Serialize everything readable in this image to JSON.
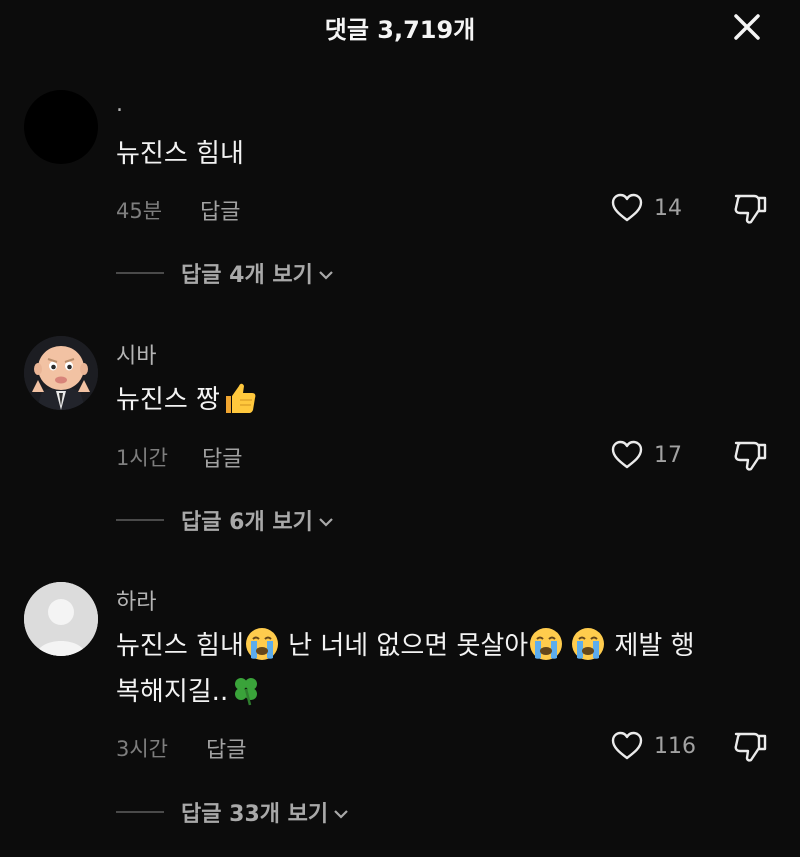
{
  "header": {
    "title": "댓글 3,719개",
    "close_icon": "close-icon"
  },
  "comments": [
    {
      "username": ".",
      "text": "뉴진스 힘내",
      "time": "45분",
      "reply_label": "답글",
      "likes": "14",
      "view_replies": "답글 4개 보기",
      "avatar": "black-avatar"
    },
    {
      "username": "시바",
      "text": "뉴진스 짱",
      "time": "1시간",
      "reply_label": "답글",
      "likes": "17",
      "view_replies": "답글 6개 보기",
      "avatar": "baby-avatar"
    },
    {
      "username": "하라",
      "text_part1": "뉴진스 힘내",
      "text_part2": " 난 너네 없으면 못살아",
      "text_part3": " 제발 행",
      "text_line2": "복해지길..",
      "time": "3시간",
      "reply_label": "답글",
      "likes": "116",
      "view_replies": "답글 33개 보기",
      "avatar": "default-avatar"
    }
  ],
  "colors": {
    "background": "#0c0c0c",
    "text": "#f3f3f3",
    "muted": "#7e7e7e"
  }
}
